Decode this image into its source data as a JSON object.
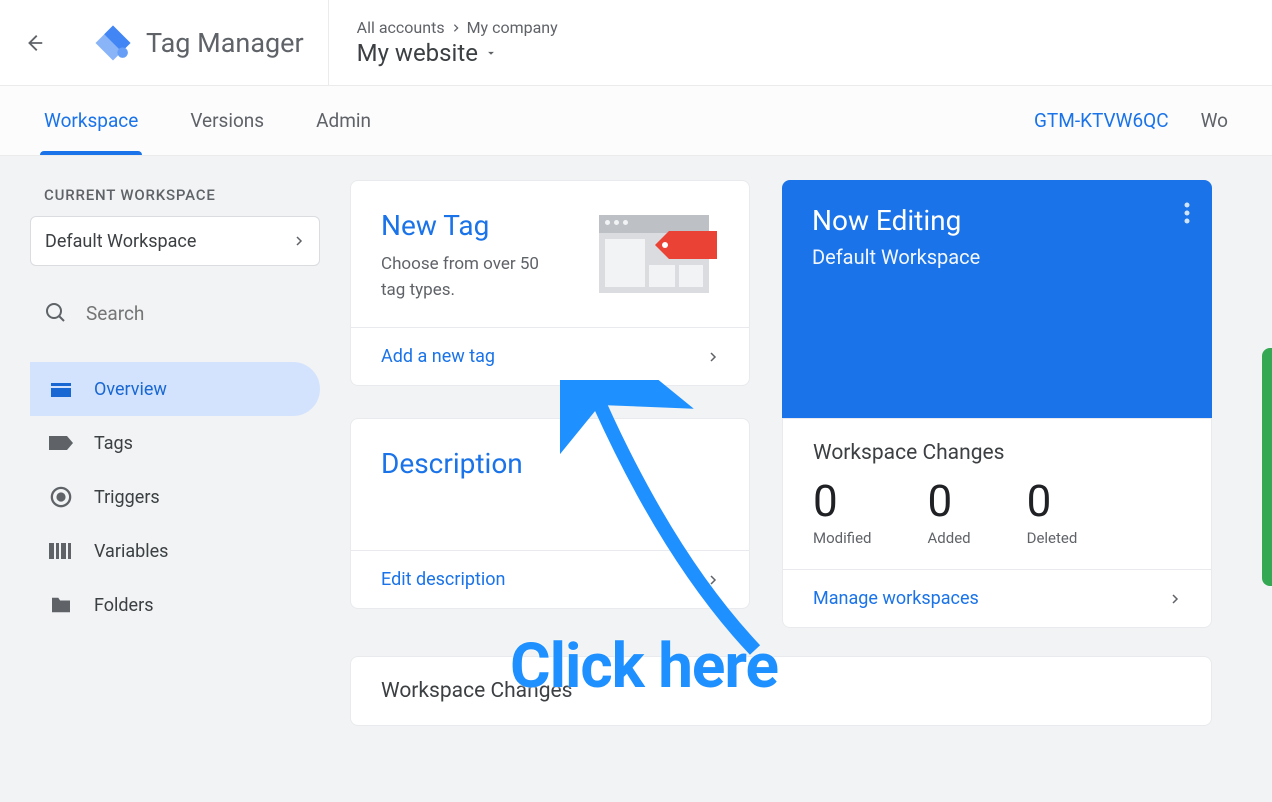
{
  "header": {
    "app_title": "Tag Manager",
    "breadcrumb_account": "All accounts",
    "breadcrumb_company": "My company",
    "container_name": "My website"
  },
  "tabs": {
    "items": [
      "Workspace",
      "Versions",
      "Admin"
    ],
    "container_id": "GTM-KTVW6QC",
    "right_link": "Wo"
  },
  "sidebar": {
    "section_label": "CURRENT WORKSPACE",
    "workspace_name": "Default Workspace",
    "search_placeholder": "Search",
    "items": [
      {
        "label": "Overview"
      },
      {
        "label": "Tags"
      },
      {
        "label": "Triggers"
      },
      {
        "label": "Variables"
      },
      {
        "label": "Folders"
      }
    ]
  },
  "newtag": {
    "title": "New Tag",
    "subtitle": "Choose from over 50 tag types.",
    "action": "Add a new tag"
  },
  "description": {
    "title": "Description",
    "action": "Edit description"
  },
  "editing": {
    "title": "Now Editing",
    "subtitle": "Default Workspace"
  },
  "changes": {
    "title": "Workspace Changes",
    "stats": [
      {
        "value": "0",
        "label": "Modified"
      },
      {
        "value": "0",
        "label": "Added"
      },
      {
        "value": "0",
        "label": "Deleted"
      }
    ],
    "action": "Manage workspaces"
  },
  "bottom_card": {
    "title": "Workspace Changes"
  },
  "annotation": {
    "text": "Click here"
  }
}
